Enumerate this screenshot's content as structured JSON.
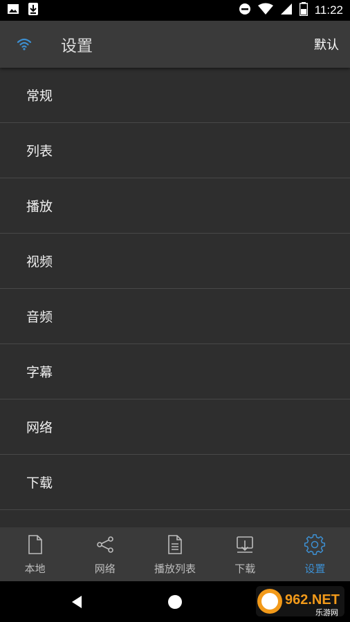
{
  "status_bar": {
    "time": "11:22",
    "icons": [
      "image-icon",
      "download-icon",
      "dnd-icon",
      "wifi-icon",
      "signal-icon",
      "battery-icon"
    ]
  },
  "app_bar": {
    "icon": "wifi-icon",
    "title": "设置",
    "action": "默认"
  },
  "settings_items": [
    "常规",
    "列表",
    "播放",
    "视频",
    "音频",
    "字幕",
    "网络",
    "下载"
  ],
  "bottom_nav": {
    "items": [
      {
        "label": "本地",
        "icon": "file-icon",
        "active": false
      },
      {
        "label": "网络",
        "icon": "share-icon",
        "active": false
      },
      {
        "label": "播放列表",
        "icon": "document-list-icon",
        "active": false
      },
      {
        "label": "下载",
        "icon": "download-tray-icon",
        "active": false
      },
      {
        "label": "设置",
        "icon": "gear-icon",
        "active": true
      }
    ]
  },
  "watermark": {
    "brand": "962.NET",
    "sub": "乐游网"
  },
  "colors": {
    "accent": "#3d8fd1",
    "app_bar": "#3a3a3a",
    "list_bg": "#2e2e2e",
    "divider": "#484848",
    "inactive": "#bdbdbd"
  }
}
